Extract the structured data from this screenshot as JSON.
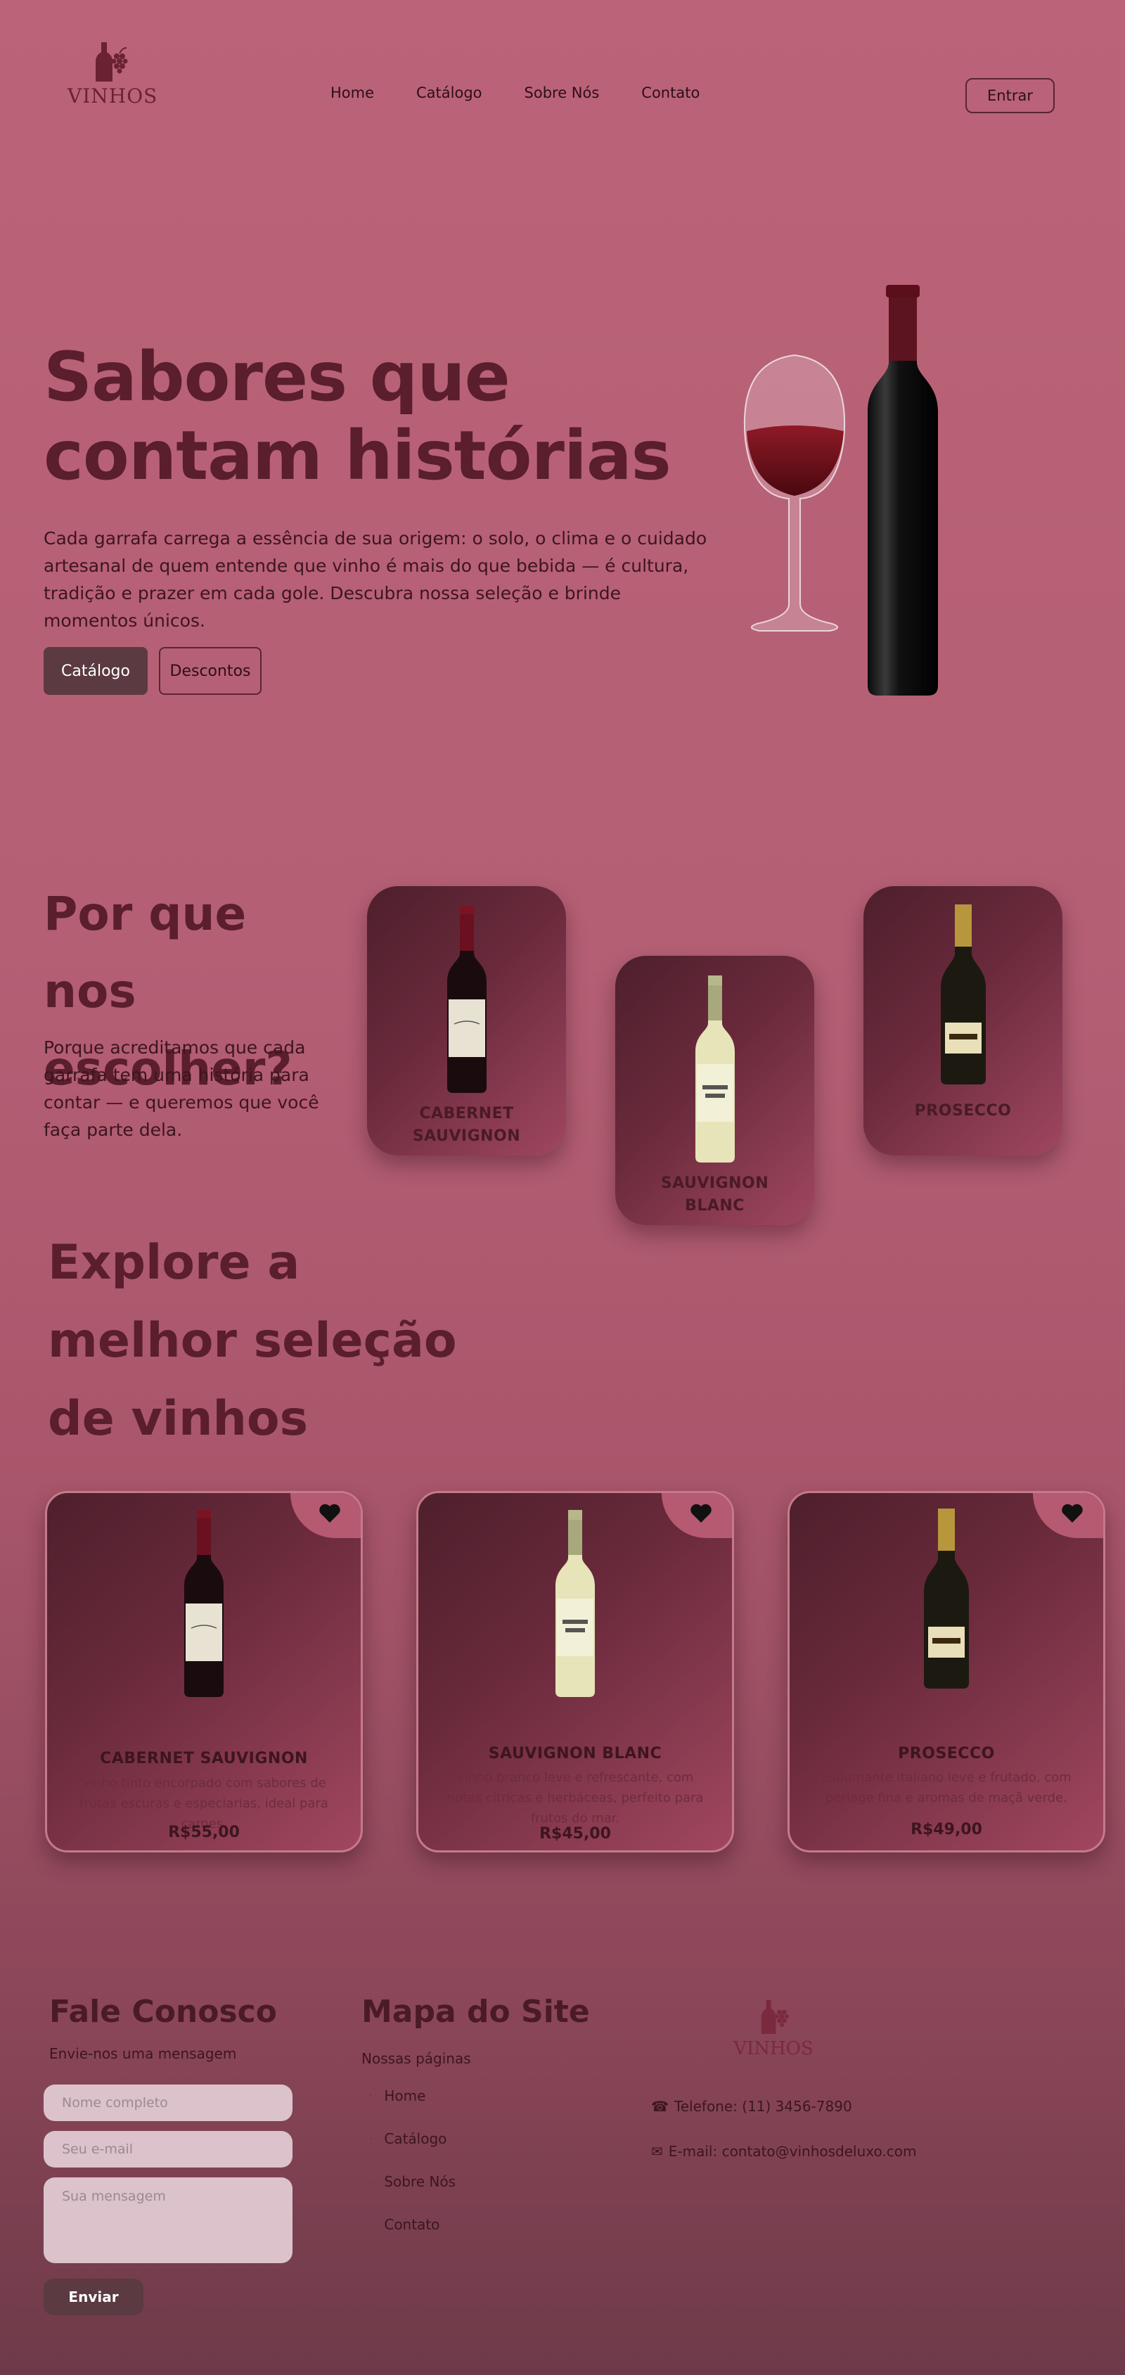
{
  "brand": {
    "logo_text": "VINHOS"
  },
  "nav": {
    "items": [
      "Home",
      "Catálogo",
      "Sobre Nós",
      "Contato"
    ],
    "login_label": "Entrar"
  },
  "hero": {
    "title_line1": "Sabores que",
    "title_line2": "contam histórias",
    "text": "Cada garrafa carrega a essência de sua origem: o solo, o clima e o cuidado artesanal de quem entende que vinho é mais do que bebida — é cultura, tradição e prazer em cada gole. Descubra nossa seleção e brinde momentos únicos.",
    "catalog_button": "Catálogo",
    "discounts_button": "Descontos"
  },
  "why": {
    "title_line1": "Por que nos",
    "title_line2": "escolher?",
    "text": "Porque acreditamos que cada garrafa tem uma história para contar — e queremos que você faça parte dela.",
    "cards": [
      {
        "line1": "CABERNET",
        "line2": "SAUVIGNON"
      },
      {
        "line1": "SAUVIGNON",
        "line2": "BLANC"
      },
      {
        "line1": "PROSECCO",
        "line2": ""
      }
    ]
  },
  "explore": {
    "title_line1": "Explore a",
    "title_line2": "melhor seleção",
    "title_line3": "de vinhos",
    "products": [
      {
        "name": "CABERNET SAUVIGNON",
        "description": "Vinho tinto encorpado com sabores de frutas escuras e especiarias, ideal para carnes.",
        "price": "R$55,00"
      },
      {
        "name": "SAUVIGNON BLANC",
        "description": "Vinho branco leve e refrescante, com notas cítricas e herbáceas, perfeito para frutos do mar.",
        "price": "R$45,00"
      },
      {
        "name": "PROSECCO",
        "description": "Espumante italiano leve e frutado, com perlage fina e aromas de maçã verde.",
        "price": "R$49,00"
      }
    ]
  },
  "contact": {
    "title": "Fale Conosco",
    "subtitle": "Envie-nos uma mensagem",
    "name_placeholder": "Nome completo",
    "email_placeholder": "Seu e-mail",
    "message_placeholder": "Sua mensagem",
    "send_label": "Enviar"
  },
  "sitemap": {
    "title": "Mapa do Site",
    "subtitle": "Nossas páginas",
    "items": [
      "Home",
      "Catálogo",
      "Sobre Nós",
      "Contato"
    ]
  },
  "info": {
    "phone": "Telefone: (11) 3456-7890",
    "email": "E-mail: contato@vinhosdeluxo.com"
  },
  "colors": {
    "accent_dark": "#5a1e2c",
    "button_dark": "#5b3a42",
    "card_start": "#4e1f2c",
    "card_end": "#a1475f"
  }
}
